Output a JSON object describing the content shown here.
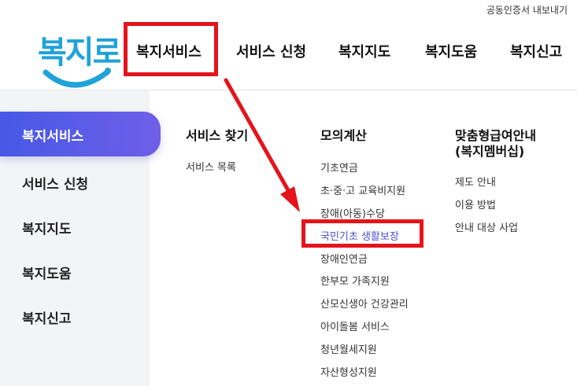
{
  "topbar": {
    "cert_export": "공동인증서 내보내기"
  },
  "logo": {
    "text": "복지로"
  },
  "gnb": {
    "items": [
      "복지서비스",
      "서비스 신청",
      "복지지도",
      "복지도움",
      "복지신고"
    ]
  },
  "sidebar": {
    "items": [
      "복지서비스",
      "서비스 신청",
      "복지지도",
      "복지도움",
      "복지신고"
    ],
    "active_index": 0
  },
  "menu": {
    "columns": [
      {
        "title": "서비스 찾기",
        "items": [
          "서비스 목록"
        ]
      },
      {
        "title": "모의계산",
        "items": [
          "기초연금",
          "초·중·고 교육비지원",
          "장애(아동)수당",
          "국민기초 생활보장",
          "장애인연금",
          "한부모 가족지원",
          "산모신생아 건강관리",
          "아이돌봄 서비스",
          "청년월세지원",
          "자산형성지원"
        ],
        "highlighted_index": 3
      },
      {
        "title_line1": "맞춤형급여안내",
        "title_line2": "(복지멤버십)",
        "items": [
          "제도 안내",
          "이용 방법",
          "안내 대상 사업"
        ]
      }
    ]
  },
  "colors": {
    "highlight_red": "#e4141b",
    "active_gradient_start": "#4659e6",
    "active_gradient_end": "#6f5ee8",
    "active_link": "#4b4fd1",
    "logo_blue": "#1fa3d8"
  }
}
